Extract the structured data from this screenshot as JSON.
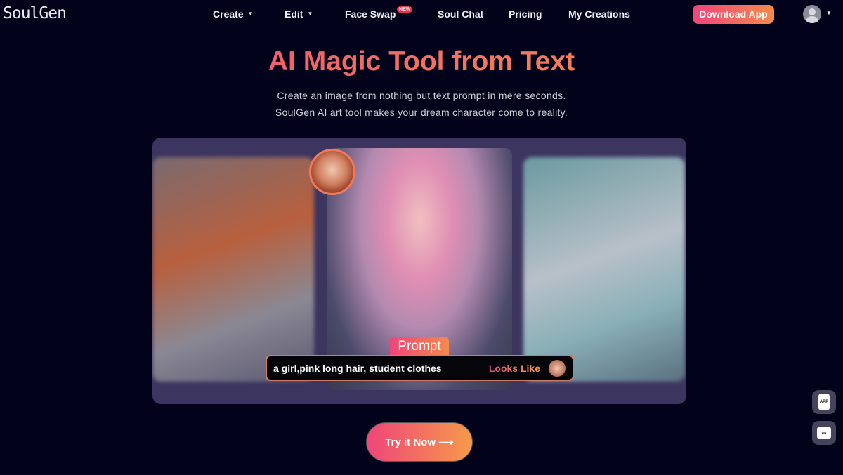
{
  "nav": {
    "logo": "SoulGen",
    "items": [
      {
        "label": "Create",
        "dropdown": true
      },
      {
        "label": "Edit",
        "dropdown": true
      },
      {
        "label": "Face Swap",
        "badge": "NEW"
      },
      {
        "label": "Soul Chat"
      },
      {
        "label": "Pricing"
      },
      {
        "label": "My Creations"
      }
    ],
    "download": "Download App"
  },
  "hero": {
    "title": "AI Magic Tool from Text",
    "line1": "Create an image from nothing but text prompt in mere seconds.",
    "line2": "SoulGen AI art tool makes your dream character come to reality."
  },
  "prompt": {
    "tag": "Prompt",
    "text": "a girl,pink long hair, student clothes",
    "looks_like": "Looks Like"
  },
  "cta": {
    "label": "Try it Now",
    "icon": "arrow-right-icon"
  },
  "floating": {
    "app": "APP",
    "chat": "••"
  },
  "colors": {
    "accent_start": "#f0457a",
    "accent_end": "#f59a4a",
    "background": "#02031a"
  }
}
